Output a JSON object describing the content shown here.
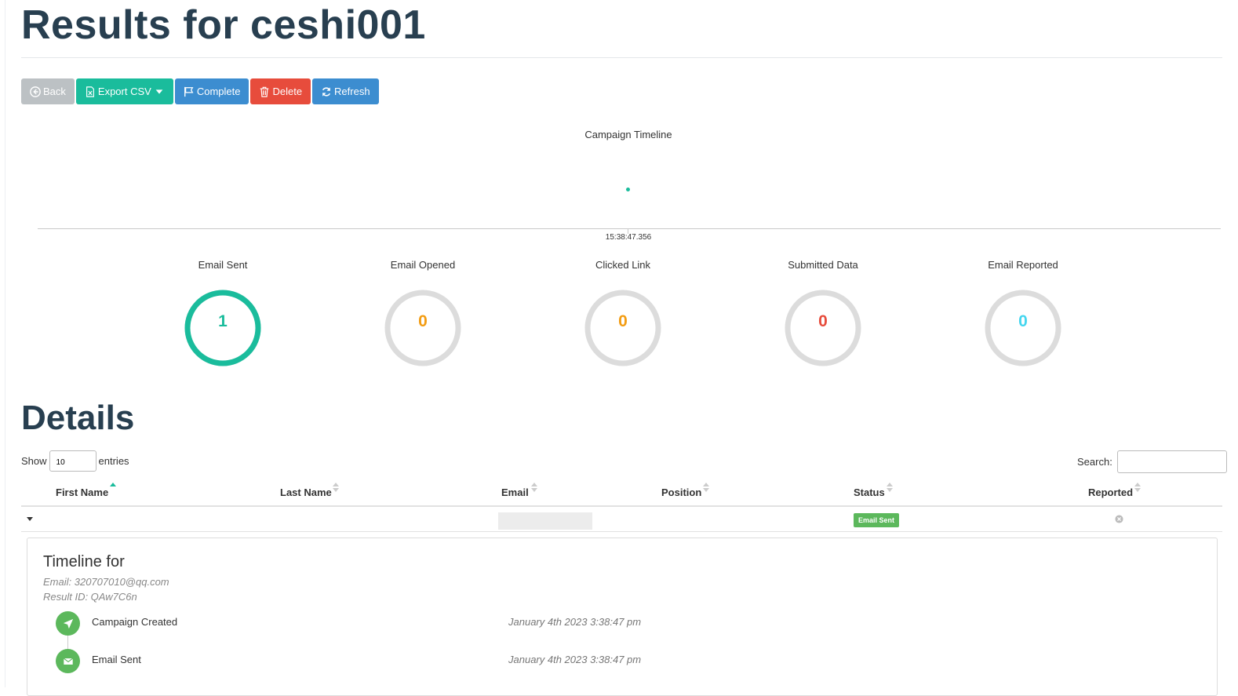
{
  "page": {
    "title": "Results for ceshi001"
  },
  "toolbar": {
    "back": "Back",
    "export": "Export CSV",
    "complete": "Complete",
    "delete": "Delete",
    "refresh": "Refresh"
  },
  "timeline": {
    "title": "Campaign Timeline",
    "point_label": "15:38:47.356"
  },
  "stats": [
    {
      "label": "Email Sent",
      "value": "1",
      "color": "#1abc9c",
      "fraction": 1
    },
    {
      "label": "Email Opened",
      "value": "0",
      "color": "#f39c12",
      "fraction": 0
    },
    {
      "label": "Clicked Link",
      "value": "0",
      "color": "#f39c12",
      "fraction": 0
    },
    {
      "label": "Submitted Data",
      "value": "0",
      "color": "#e74c3c",
      "fraction": 0
    },
    {
      "label": "Email Reported",
      "value": "0",
      "color": "#45d6ef",
      "fraction": 0
    }
  ],
  "details": {
    "title": "Details",
    "show_label": "Show",
    "entries_value": "10",
    "entries_label": "entries",
    "search_label": "Search:",
    "columns": [
      "First Name",
      "Last Name",
      "Email",
      "Position",
      "Status",
      "Reported"
    ],
    "row": {
      "status": "Email Sent"
    }
  },
  "result_timeline": {
    "title": "Timeline for",
    "email": "Email: 320707010@qq.com",
    "result_id": "Result ID: QAw7C6n",
    "events": [
      {
        "label": "Campaign Created",
        "time": "January 4th 2023 3:38:47 pm",
        "icon": "rocket-icon"
      },
      {
        "label": "Email Sent",
        "time": "January 4th 2023 3:38:47 pm",
        "icon": "envelope-icon"
      }
    ]
  }
}
